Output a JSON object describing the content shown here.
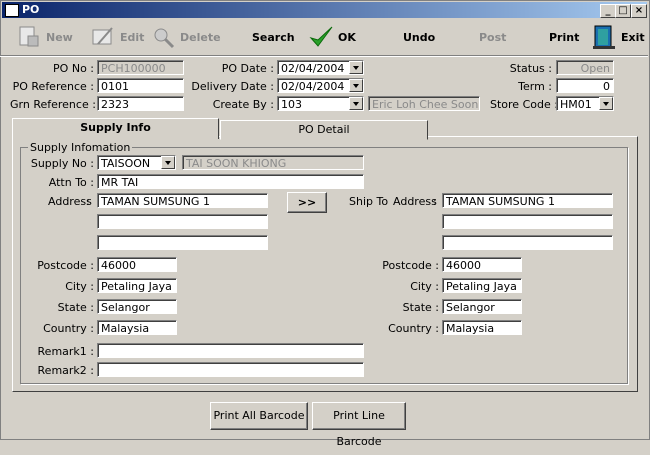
{
  "window": {
    "title": "PO",
    "min": "_",
    "max": "□",
    "close": "×"
  },
  "toolbar": {
    "new": "New",
    "edit": "Edit",
    "delete": "Delete",
    "search": "Search",
    "ok": "OK",
    "undo": "Undo",
    "post": "Post",
    "print": "Print",
    "exit": "Exit"
  },
  "header": {
    "po_no_label": "PO No :",
    "po_no": "PCH100000",
    "po_ref_label": "PO Reference :",
    "po_ref": "0101",
    "grn_ref_label": "Grn Reference :",
    "grn_ref": "2323",
    "po_date_label": "PO Date :",
    "po_date": "02/04/2004",
    "delivery_label": "Delivery Date :",
    "delivery_date": "02/04/2004",
    "create_by_label": "Create By :",
    "create_by": "103",
    "create_by_name": "Eric Loh Chee Soon",
    "status_label": "Status :",
    "status": "Open",
    "term_label": "Term :",
    "term": "0",
    "store_label": "Store Code :",
    "store": "HM01"
  },
  "tabs": {
    "supply_info": "Supply Info",
    "po_detail": "PO Detail"
  },
  "supply": {
    "group_title": "Supply Infomation",
    "supply_no_label": "Supply No :",
    "supply_no": "TAISOON",
    "supply_name": "TAI SOON KHIONG",
    "attn_label": "Attn To :",
    "attn": "MR TAI",
    "address_label": "Address",
    "addr1": "TAMAN SUMSUNG 1",
    "addr2": "",
    "addr3": "",
    "copy_button": ">>",
    "postcode_label": "Postcode :",
    "postcode": "46000",
    "city_label": "City :",
    "city": "Petaling Jaya",
    "state_label": "State :",
    "state": "Selangor",
    "country_label": "Country :",
    "country": "Malaysia",
    "remark1_label": "Remark1 :",
    "remark1": "",
    "remark2_label": "Remark2 :",
    "remark2": ""
  },
  "ship": {
    "ship_to_label": "Ship To",
    "address_label": "Address",
    "addr1": "TAMAN SUMSUNG 1",
    "addr2": "",
    "addr3": "",
    "postcode_label": "Postcode :",
    "postcode": "46000",
    "city_label": "City :",
    "city": "Petaling Jaya",
    "state_label": "State :",
    "state": "Selangor",
    "country_label": "Country :",
    "country": "Malaysia"
  },
  "buttons": {
    "print_all": "Print All Barcode",
    "print_line": "Print Line Barcode"
  }
}
